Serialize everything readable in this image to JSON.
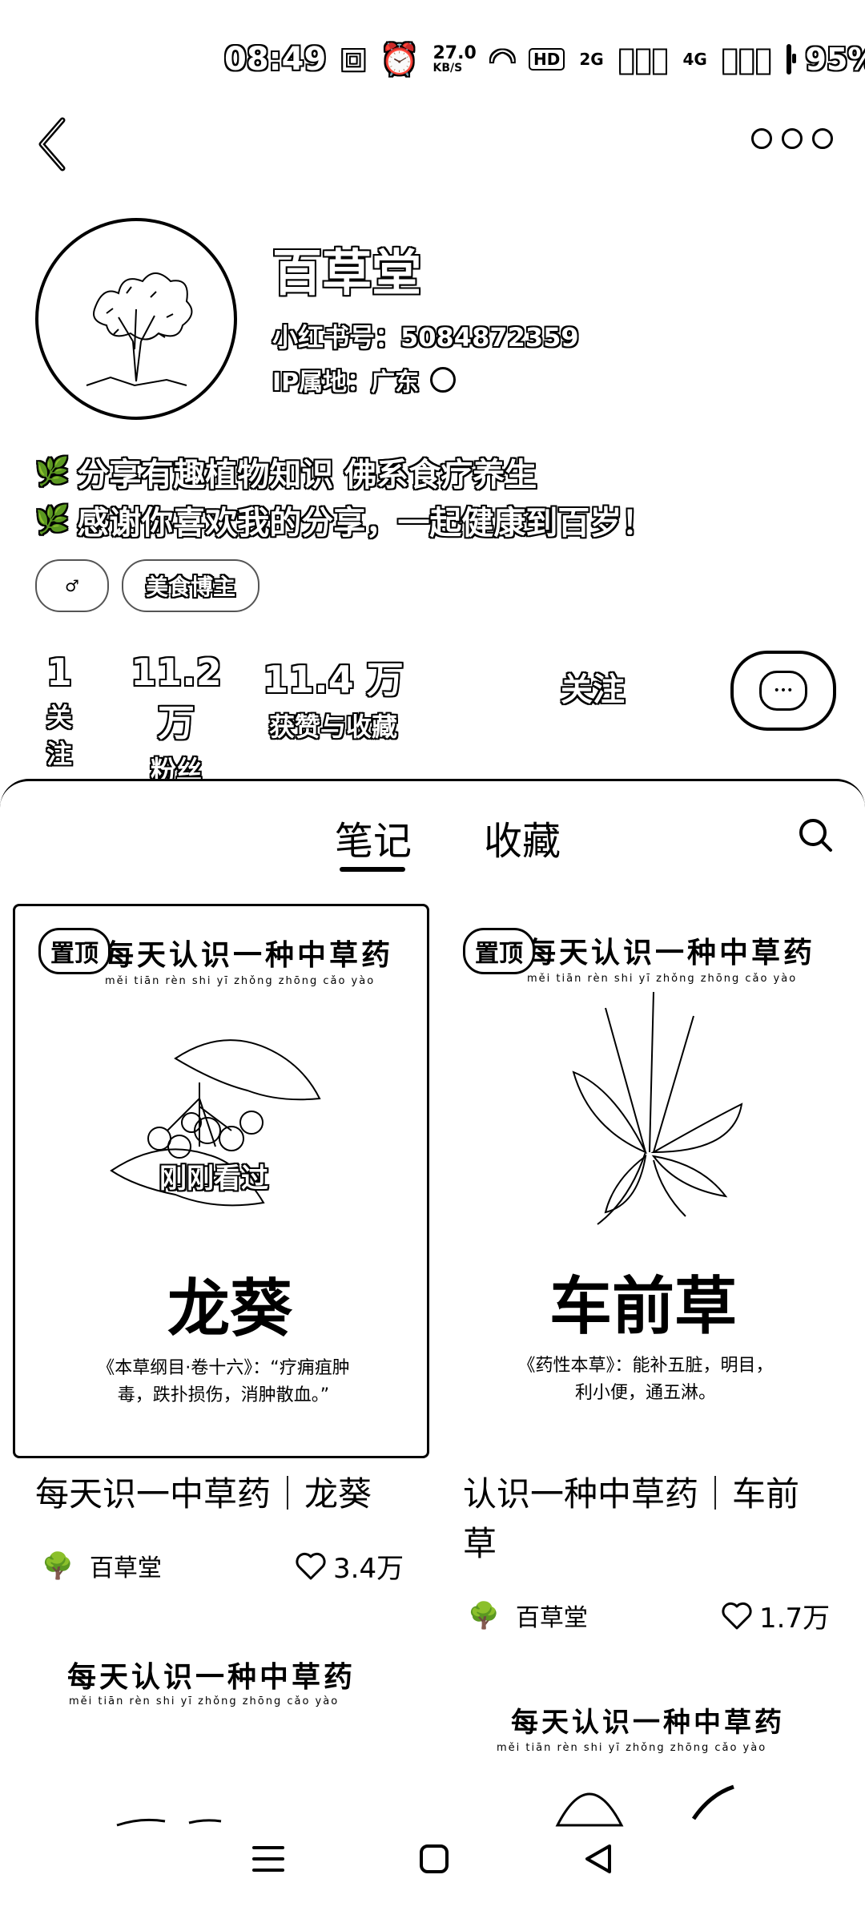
{
  "status_bar": {
    "time": "08:49",
    "net_speed": "27.0",
    "net_unit": "KB/S",
    "hd_label": "HD",
    "signal1": "2G",
    "signal2": "4G",
    "battery": "95%"
  },
  "profile": {
    "name": "百草堂",
    "xhs_id": "小红书号：5084872359",
    "ip": "IP属地：广东",
    "bio": [
      "分享有趣植物知识 佛系食疗养生",
      "感谢你喜欢我的分享，一起健康到百岁！"
    ],
    "tags": [
      "",
      "美食博主"
    ]
  },
  "stats": [
    {
      "num": "1",
      "label": "关注"
    },
    {
      "num": "11.2 万",
      "label": "粉丝"
    },
    {
      "num": "11.4 万",
      "label": "获赞与收藏"
    }
  ],
  "follow_label": "关注",
  "tabs": [
    "笔记",
    "收藏"
  ],
  "notes": [
    {
      "pin": "置顶",
      "heading": "每天认识一种中草药",
      "pinyin": "měi tiān rèn shi yī zhǒng zhōng cǎo yào",
      "plant": "龙葵",
      "quote_line1": "《本草纲目·卷十六》：“疗痈疽肿",
      "quote_line2": "毒，跌扑损伤，消肿散血。”",
      "recent": "刚刚看过",
      "title": "每天识一中草药｜龙葵",
      "author": "百草堂",
      "likes": "3.4万"
    },
    {
      "pin": "置顶",
      "heading": "每天认识一种中草药",
      "pinyin": "měi tiān rèn shi yī zhǒng zhōng cǎo yào",
      "plant": "车前草",
      "quote_line1": "《药性本草》：能补五脏，明目，",
      "quote_line2": "利小便，通五淋。",
      "title_line1": "认识一种中草药｜车前",
      "title_line2": "草",
      "author": "百草堂",
      "likes": "1.7万"
    },
    {
      "heading": "每天认识一种中草药",
      "pinyin": "měi tiān rèn shi yī zhǒng zhōng cǎo yào"
    },
    {
      "heading": "每天认识一种中草药",
      "pinyin": "měi tiān rèn shi yī zhǒng zhōng cǎo yào"
    }
  ]
}
